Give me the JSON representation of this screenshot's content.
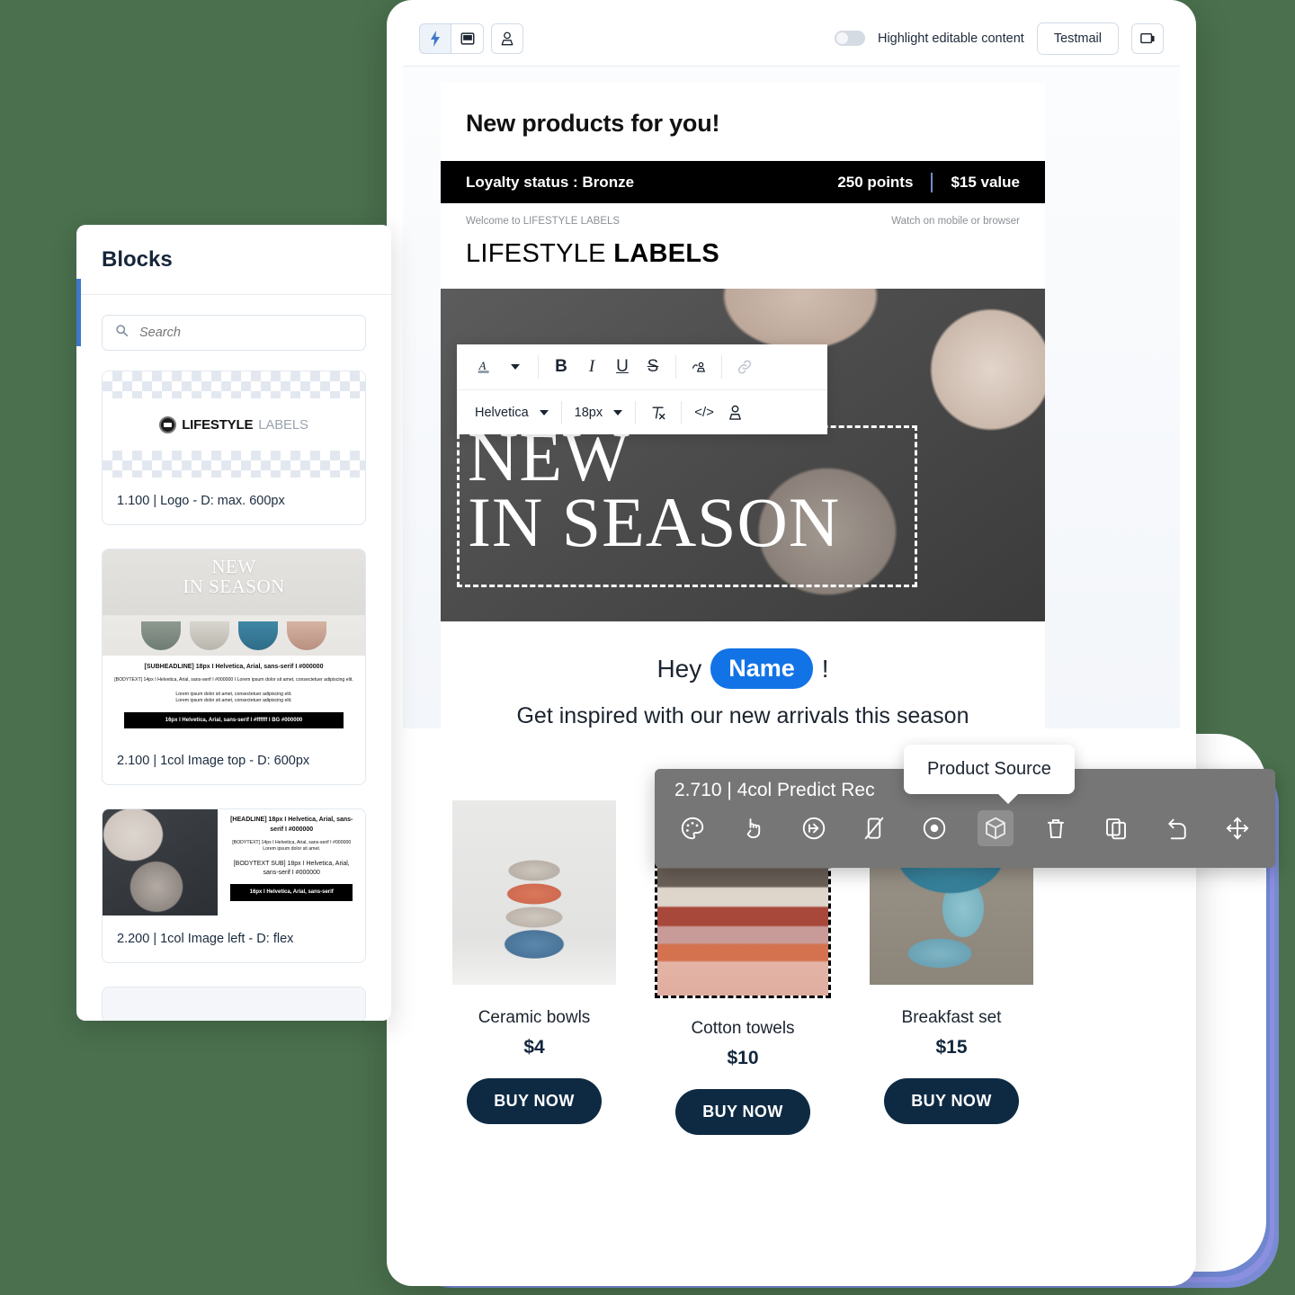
{
  "toolbar": {
    "mode_lightning": "lightning-icon",
    "mode_desktop": "desktop-icon",
    "mode_person": "person-icon",
    "highlight_label": "Highlight editable content",
    "highlight_state": "off",
    "testmail_label": "Testmail",
    "preview_device_icon": "device-preview-icon"
  },
  "blocks_panel": {
    "title": "Blocks",
    "search_placeholder": "Search",
    "items": [
      {
        "label": "1.100 | Logo - D: max. 600px",
        "logo_bold": "LIFESTYLE",
        "logo_light": "LABELS"
      },
      {
        "label": "2.100 | 1col Image top - D: 600px",
        "hero_line1": "NEW",
        "hero_line2": "IN SEASON",
        "spec_sub": "[SUBHEADLINE] 18px I Helvetica, Arial, sans-serif I #000000",
        "spec_body": "[BODYTEXT] 14px I Helvetica, Arial, sans-serif I #000000 I Lorem ipsum dolor sit amet, consectetuer adipiscing elit.",
        "spec_lorem1": "Lorem ipsum dolor sit amet, consectetuer adipiscing elit.",
        "spec_lorem2": "Lorem ipsum dolor sit amet, consectetuer adipiscing elit.",
        "spec_btn": "16px I Helvetica, Arial, sans-serif I #ffffff I BG #000000"
      },
      {
        "label": "2.200 | 1col Image left - D: flex",
        "spec_head": "[HEADLINE] 18px I Helvetica, Arial, sans-serif I #000000",
        "spec_body": "[BODYTEXT] 14px I Helvetica, Arial, sans-serif I #000000",
        "spec_lorem": "Lorem ipsum dolor sit amet.",
        "spec_sub": "[BODYTEXT SUB] 18px I Helvetica, Arial, sans-serif I #000000",
        "spec_btn": "16px I Helvetica, Arial, sans-serif"
      }
    ]
  },
  "email": {
    "headline": "New products for you!",
    "loyalty_status": "Loyalty status : Bronze",
    "loyalty_points": "250 points",
    "loyalty_value": "$15 value",
    "preheader_left": "Welcome to LIFESTYLE LABELS",
    "preheader_right": "Watch on mobile or browser",
    "brand_light": "LIFESTYLE",
    "brand_bold": "LABELS",
    "hero_line1": "NEW",
    "hero_line2": "IN SEASON",
    "greeting_prefix": "Hey",
    "greeting_chip": "Name",
    "greeting_suffix": "!",
    "greeting_sub": "Get inspired with our new arrivals this season",
    "products": [
      {
        "name": "Ceramic bowls",
        "price": "$4",
        "cta": "BUY NOW",
        "selected": false
      },
      {
        "name": "Cotton towels",
        "price": "$10",
        "cta": "BUY NOW",
        "selected": true
      },
      {
        "name": "Breakfast set",
        "price": "$15",
        "cta": "BUY NOW",
        "selected": false
      }
    ]
  },
  "rich_text_editor": {
    "font_color_icon": "font-color-icon",
    "bold": "B",
    "italic": "I",
    "underline": "U",
    "strikethrough": "S",
    "personalize_icon": "personalize-icon",
    "link_icon": "link-icon",
    "font_family": "Helvetica",
    "font_size": "18px",
    "clear_format_icon": "clear-formatting-icon",
    "code_icon": "code-icon",
    "merge_person_icon": "person-merge-icon"
  },
  "context_toolbar": {
    "title": "2.710 | 4col Predict Rec",
    "tooltip": "Product Source",
    "icons": [
      "palette-icon",
      "click-interaction-icon",
      "link-arrow-icon",
      "hide-mobile-icon",
      "target-icon",
      "product-source-box-icon",
      "trash-icon",
      "duplicate-icon",
      "revert-icon",
      "move-icon"
    ],
    "active_index": 5
  },
  "colors": {
    "page_background": "#4a704d",
    "accent_blue": "#1273e6",
    "dark_navy": "#0e2a43",
    "toolbar_gray": "#767676",
    "loyalty_bar": "#000000"
  }
}
